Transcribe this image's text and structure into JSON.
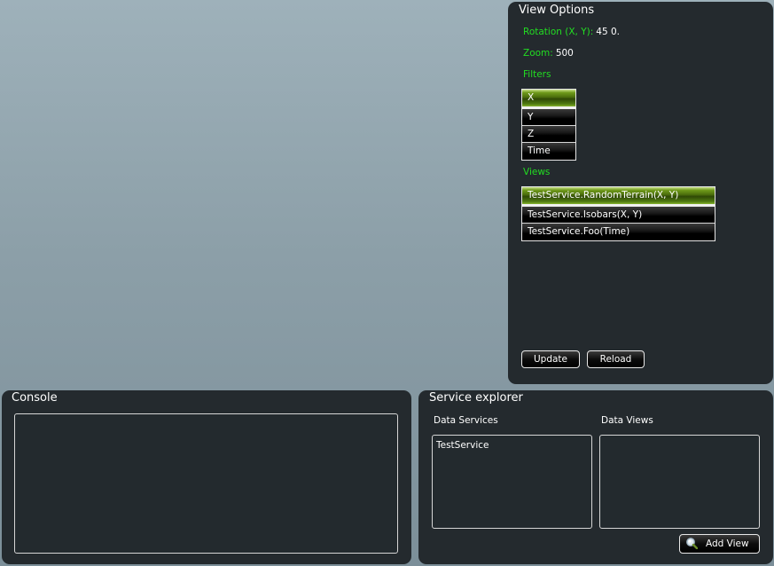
{
  "view_options": {
    "title": "View Options",
    "rotation_label": "Rotation (X, Y):",
    "rotation_value": "45 0.",
    "zoom_label": "Zoom:",
    "zoom_value": "500",
    "filters_label": "Filters",
    "filters": [
      "X",
      "Y",
      "Z",
      "Time"
    ],
    "filters_selected": "X",
    "views_label": "Views",
    "views": [
      "TestService.RandomTerrain(X, Y)",
      "TestService.Isobars(X, Y)",
      "TestService.Foo(Time)"
    ],
    "views_selected": "TestService.RandomTerrain(X, Y)",
    "update_label": "Update",
    "reload_label": "Reload"
  },
  "console": {
    "title": "Console",
    "text": ""
  },
  "service_explorer": {
    "title": "Service explorer",
    "data_services_label": "Data Services",
    "data_views_label": "Data Views",
    "data_services": [
      "TestService"
    ],
    "data_views": [],
    "add_view_label": "Add View",
    "add_view_icon": "magnifier-icon"
  },
  "colors": {
    "panel_bg": "#242a2e",
    "label_green": "#22dd22",
    "selection_green": "#4a6d0c"
  }
}
